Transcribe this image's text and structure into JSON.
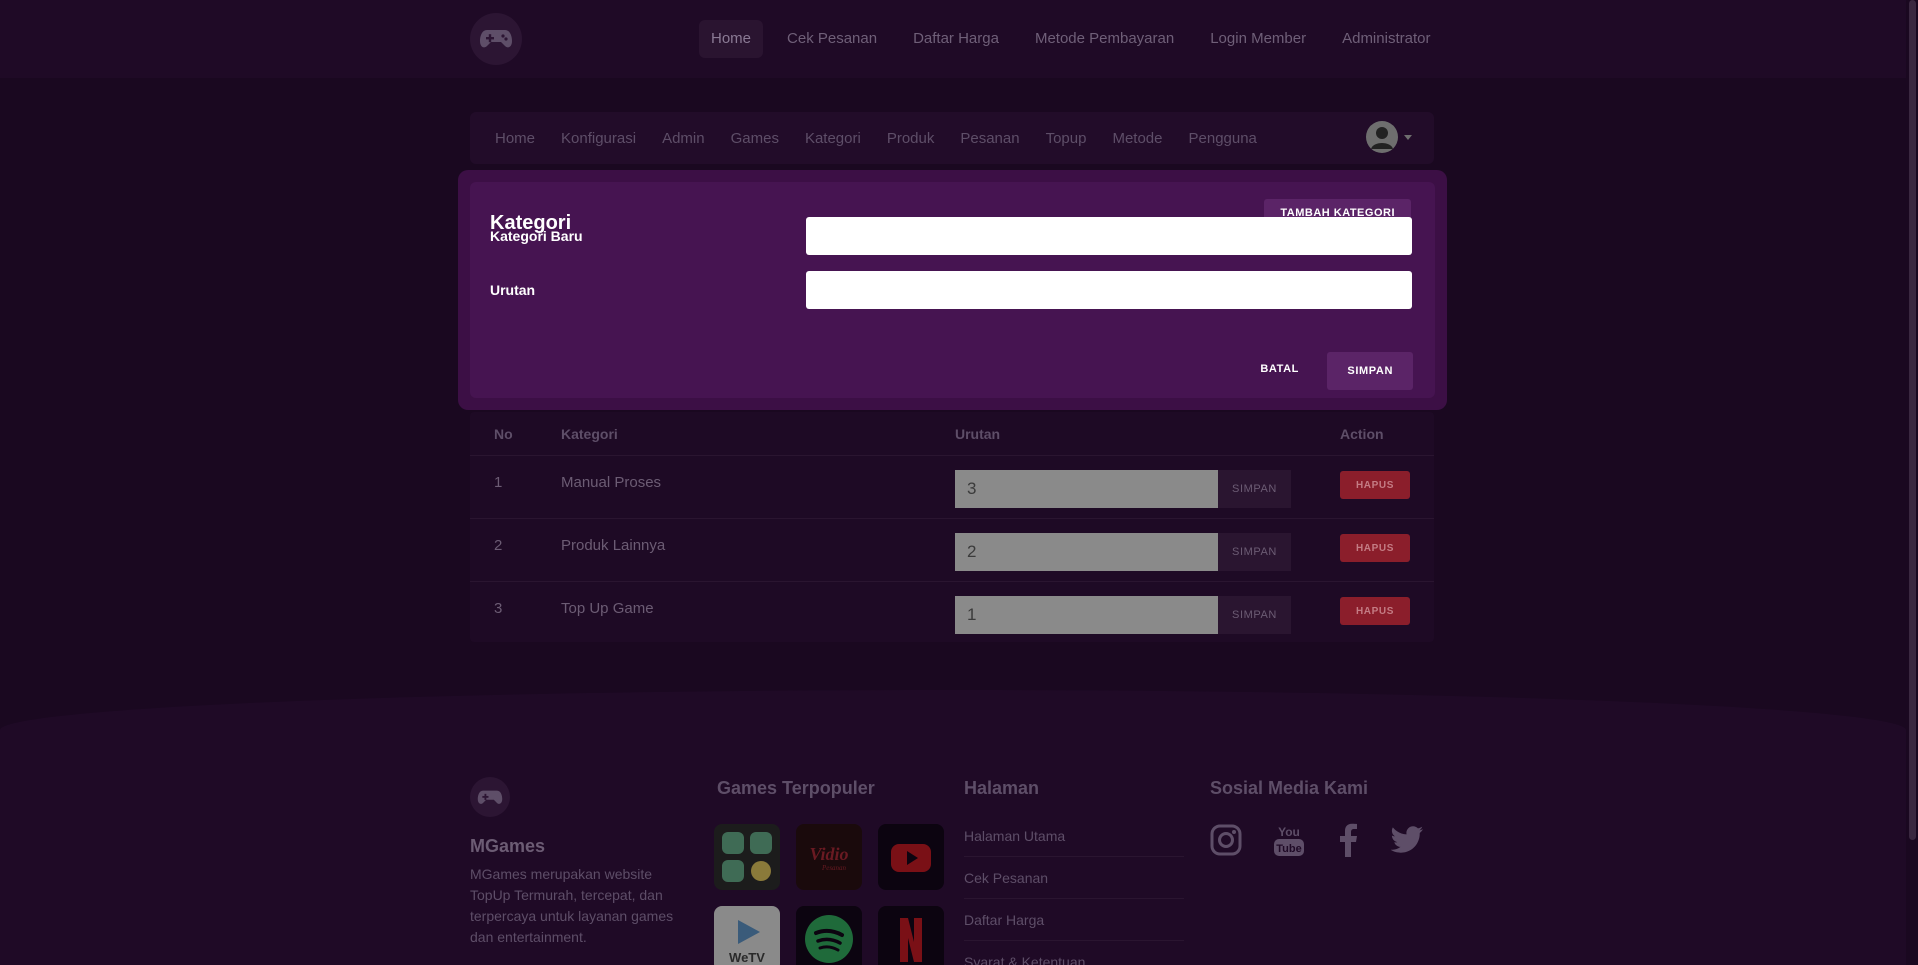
{
  "topnav": {
    "items": [
      "Home",
      "Cek Pesanan",
      "Daftar Harga",
      "Metode Pembayaran",
      "Login Member",
      "Administrator"
    ]
  },
  "adminnav": {
    "items": [
      "Home",
      "Konfigurasi",
      "Admin",
      "Games",
      "Kategori",
      "Produk",
      "Pesanan",
      "Topup",
      "Metode",
      "Pengguna"
    ]
  },
  "modal": {
    "title": "Kategori",
    "add_label": "TAMBAH KATEGORI",
    "field1_label": "Kategori Baru",
    "field1_value": "",
    "field2_label": "Urutan",
    "field2_value": "",
    "cancel_label": "BATAL",
    "save_label": "SIMPAN"
  },
  "table": {
    "headers": [
      "No",
      "Kategori",
      "Urutan",
      "Action"
    ],
    "rows": [
      {
        "no": "1",
        "kategori": "Manual Proses",
        "urutan": "3",
        "save": "SIMPAN",
        "delete": "HAPUS"
      },
      {
        "no": "2",
        "kategori": "Produk Lainnya",
        "urutan": "2",
        "save": "SIMPAN",
        "delete": "HAPUS"
      },
      {
        "no": "3",
        "kategori": "Top Up Game",
        "urutan": "1",
        "save": "SIMPAN",
        "delete": "HAPUS"
      }
    ]
  },
  "footer": {
    "brand": "MGames",
    "description": "MGames merupakan website TopUp Termurah, tercepat, dan terpercaya untuk layanan games dan entertainment.",
    "games_heading": "Games Terpopuler",
    "pages_heading": "Halaman",
    "pages": [
      "Halaman Utama",
      "Cek Pesanan",
      "Daftar Harga",
      "Syarat & Ketentuan"
    ],
    "social_heading": "Sosial Media Kami",
    "social": [
      "instagram-icon",
      "youtube-icon",
      "facebook-icon",
      "twitter-icon"
    ],
    "games": [
      "apps-icon",
      "vidio-icon",
      "youtube-icon",
      "wetv-icon",
      "spotify-icon",
      "netflix-icon"
    ],
    "vidio_text": "Vidio",
    "vidio_sub": "Pesanan",
    "wetv_text": "WeTV",
    "youtube_word": "You",
    "youtube_word2": "Tube"
  },
  "colors": {
    "background": "#1a0820",
    "modal": "#461451",
    "accent": "#5b2467",
    "danger": "#8b1e2b"
  }
}
